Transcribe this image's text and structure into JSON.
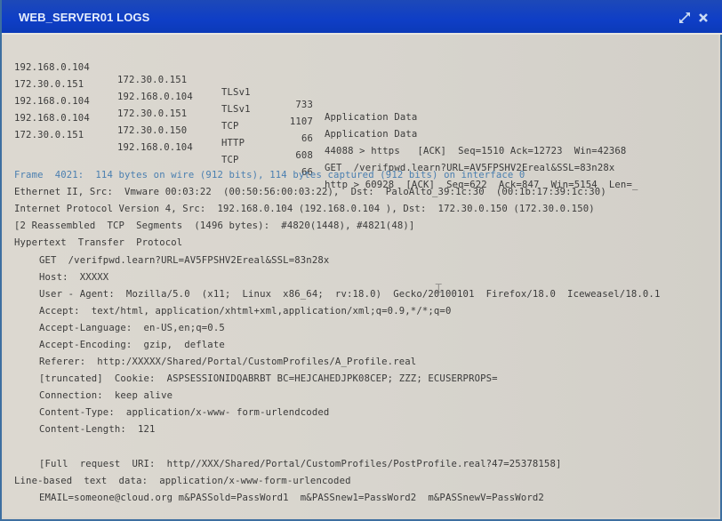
{
  "window": {
    "title": "WEB_SERVER01 LOGS",
    "icons": {
      "expand": "expand-icon",
      "close": "close-icon"
    }
  },
  "packets": [
    {
      "src": "192.168.0.104",
      "dst": "172.30.0.151",
      "proto": "TLSv1",
      "len": "733",
      "info": "Application Data"
    },
    {
      "src": "172.30.0.151",
      "dst": "192.168.0.104",
      "proto": "TLSv1",
      "len": "1107",
      "info": "Application Data"
    },
    {
      "src": "192.168.0.104",
      "dst": "172.30.0.151",
      "proto": "TCP",
      "len": "66",
      "info": "44088 > https   [ACK]  Seq=1510 Ack=12723  Win=42368"
    },
    {
      "src": "192.168.0.104",
      "dst": "172.30.0.150",
      "proto": "HTTP",
      "len": "608",
      "info": "GET  /verifpwd.learn?URL=AV5FPSHV2Ereal&SSL=83n28x"
    },
    {
      "src": "172.30.0.151",
      "dst": "192.168.0.104",
      "proto": "TCP",
      "len": "66",
      "info": "http > 60928  [ACK]  Seq=622  Ack=847  Win=5154  Len=_"
    }
  ],
  "details": {
    "frame": "Frame  4021:  114 bytes on wire (912 bits), 114 bytes captured (912 bits) on interface 0",
    "ethernet": "Ethernet II, Src:  Vmware 00:03:22  (00:50:56:00:03:22),  Dst:  PaloAlto_39:1c:30  (00:1b:17:39:1c:30)",
    "ip": "Internet Protocol Version 4, Src:  192.168.0.104 (192.168.0.104 ), Dst:  172.30.0.150 (172.30.0.150)",
    "reassembled": "[2 Reassembled  TCP  Segments  (1496 bytes):  #4820(1448), #4821(48)]",
    "http_header": "Hypertext  Transfer  Protocol",
    "http_lines": [
      "GET  /verifpwd.learn?URL=AV5FPSHV2Ereal&SSL=83n28x",
      "Host:  XXXXX",
      "User - Agent:  Mozilla/5.0  (x11;  Linux  x86_64;  rv:18.0)  Gecko/20100101  Firefox/18.0  Iceweasel/18.0.1",
      "Accept:  text/html, application/xhtml+xml,application/xml;q=0.9,*/*;q=0",
      "Accept-Language:  en-US,en;q=0.5",
      "Accept-Encoding:  gzip,  deflate",
      "Referer:  http:/XXXXX/Shared/Portal/CustomProfiles/A_Profile.real",
      "[truncated]  Cookie:  ASPSESSIONIDQABRBT BC=HEJCAHEDJPK08CEP; ZZZ; ECUSERPROPS=",
      "Connection:  keep alive",
      "Content-Type:  application/x-www- form-urlendcoded",
      "Content-Length:  121"
    ],
    "full_uri": "[Full  request  URI:  http//XXX/Shared/Portal/CustomProfiles/PostProfile.real?47=25378158]",
    "line_based": "Line-based  text  data:  application/x-www-form-urlencoded",
    "form_data": "EMAIL=someone@cloud.org m&PASSold=PassWord1  m&PASSnew1=PassWord2  m&PASSnewV=PassWord2"
  }
}
